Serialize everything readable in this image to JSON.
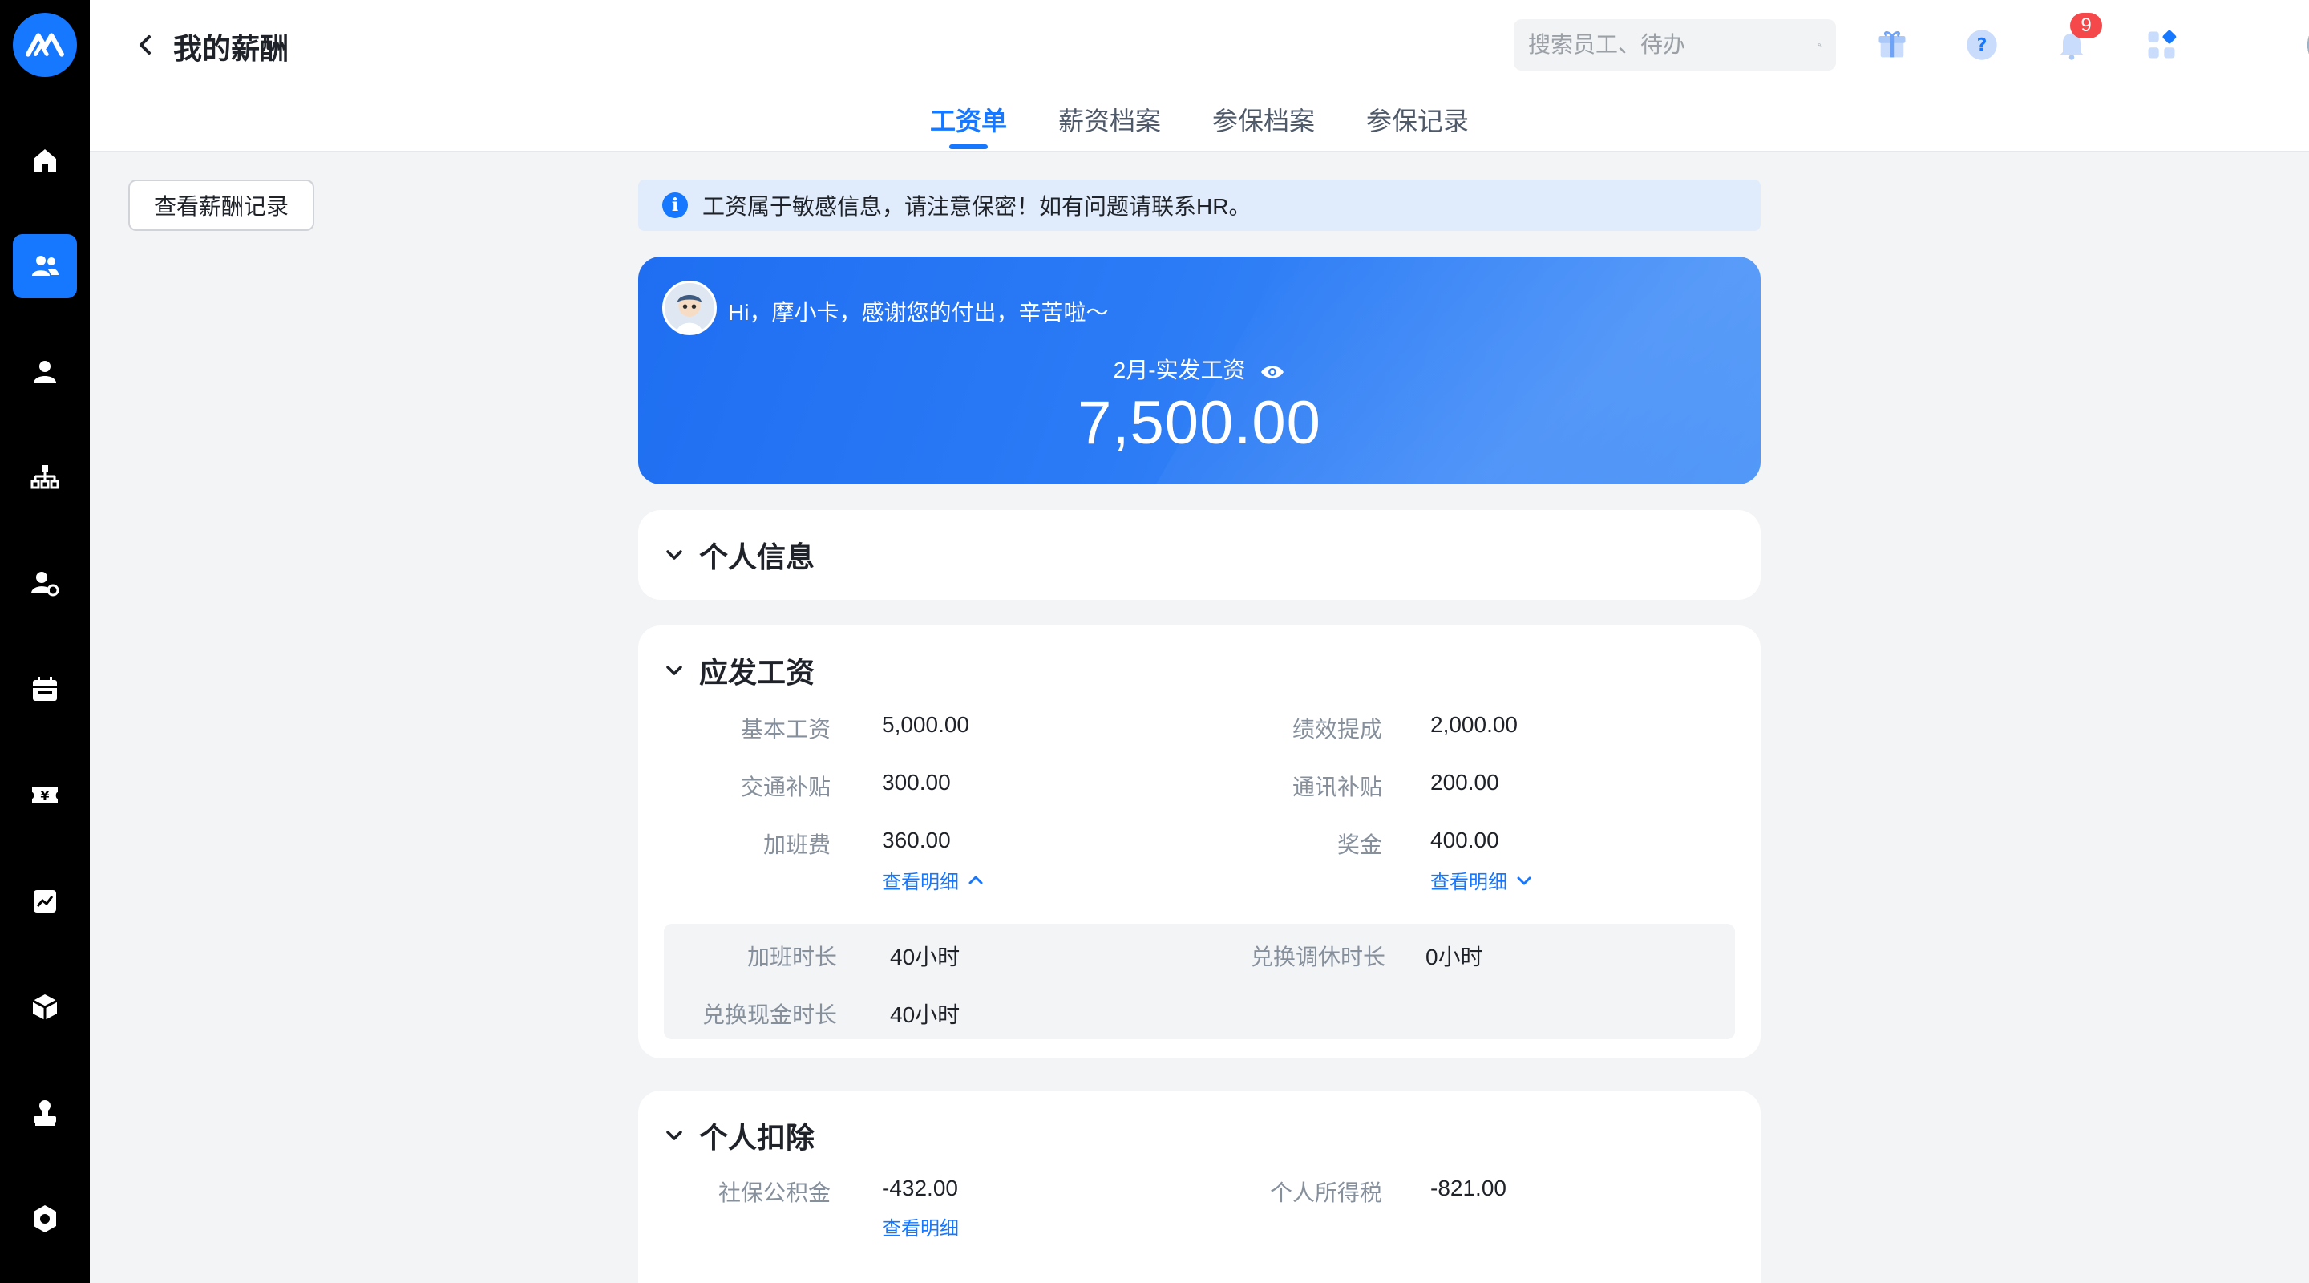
{
  "header": {
    "title": "我的薪酬",
    "search_placeholder": "搜索员工、待办",
    "notification_count": "9"
  },
  "tabs": [
    {
      "label": "工资单",
      "active": true
    },
    {
      "label": "薪资档案",
      "active": false
    },
    {
      "label": "参保档案",
      "active": false
    },
    {
      "label": "参保记录",
      "active": false
    }
  ],
  "sidebar": {
    "items": [
      {
        "icon": "home-icon",
        "active": false
      },
      {
        "icon": "people-icon",
        "active": true
      },
      {
        "icon": "person-icon",
        "active": false
      },
      {
        "icon": "org-chart-icon",
        "active": false
      },
      {
        "icon": "user-settings-icon",
        "active": false
      },
      {
        "icon": "calendar-icon",
        "active": false
      },
      {
        "icon": "salary-ticket-icon",
        "active": false
      },
      {
        "icon": "report-chart-icon",
        "active": false
      },
      {
        "icon": "box-icon",
        "active": false
      },
      {
        "icon": "stamp-person-icon",
        "active": false
      },
      {
        "icon": "settings-gear-icon",
        "active": false
      }
    ]
  },
  "main": {
    "history_button": "查看薪酬记录",
    "notice": "工资属于敏感信息，请注意保密！如有问题请联系HR。",
    "hero": {
      "greeting": "Hi，摩小卡，感谢您的付出，辛苦啦～",
      "label": "2月-实发工资",
      "amount": "7,500.00"
    },
    "personal_info": {
      "title": "个人信息"
    },
    "gross_pay": {
      "title": "应发工资",
      "fields": [
        {
          "label": "基本工资",
          "value": "5,000.00"
        },
        {
          "label": "绩效提成",
          "value": "2,000.00"
        },
        {
          "label": "交通补贴",
          "value": "300.00"
        },
        {
          "label": "通讯补贴",
          "value": "200.00"
        },
        {
          "label": "加班费",
          "value": "360.00"
        },
        {
          "label": "奖金",
          "value": "400.00"
        }
      ],
      "detail_link_left": "查看明细",
      "detail_link_right": "查看明细",
      "overtime": [
        {
          "label": "加班时长",
          "value": "40小时"
        },
        {
          "label": "兑换调休时长",
          "value": "0小时"
        },
        {
          "label": "兑换现金时长",
          "value": "40小时"
        }
      ]
    },
    "deductions": {
      "title": "个人扣除",
      "fields": [
        {
          "label": "社保公积金",
          "value": "-432.00"
        },
        {
          "label": "个人所得税",
          "value": "-821.00"
        }
      ],
      "detail_link": "查看明细"
    }
  },
  "colors": {
    "brand": "#1677ff",
    "rail_bg": "#000000",
    "badge": "#f5484a"
  }
}
